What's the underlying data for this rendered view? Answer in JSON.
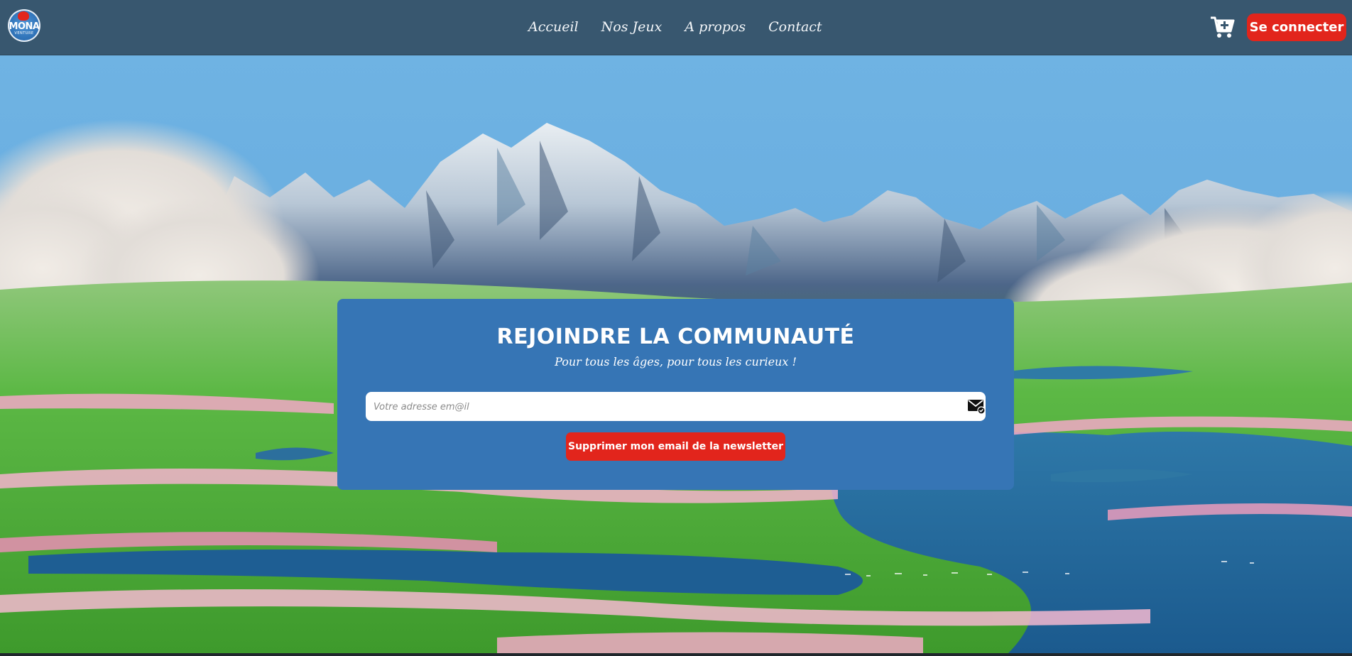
{
  "header": {
    "logo": {
      "text": "MONA",
      "subtext": "VENTURE"
    },
    "nav_links": [
      "Accueil",
      "Nos Jeux",
      "A propos",
      "Contact"
    ],
    "cart_icon": "cart-plus-icon",
    "login_label": "Se connecter"
  },
  "newsletter": {
    "title": "REJOINDRE LA COMMUNAUTÉ",
    "subtitle": "Pour tous les âges, pour tous les curieux !",
    "email_placeholder": "Votre adresse em@il",
    "email_value": "",
    "submit_icon": "mail-check-icon",
    "unsubscribe_label": "Supprimer mon email de la newsletter"
  },
  "colors": {
    "header_bg": "#38576f",
    "accent_red": "#e2251c",
    "card_blue": "#3675b5",
    "sky": "#6fb3e3"
  }
}
